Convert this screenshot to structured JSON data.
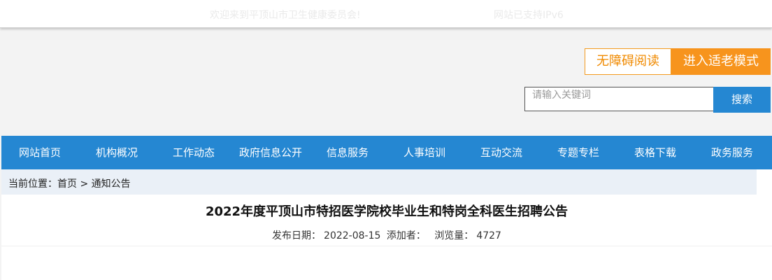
{
  "topbar": {
    "welcome": "欢迎来到平顶山市卫生健康委员会!",
    "ipv6": "网站已支持IPv6"
  },
  "tools": {
    "accessibility_label": "无障碍阅读",
    "elder_mode_label": "进入适老模式"
  },
  "search": {
    "placeholder": "请输入关键词",
    "value": "",
    "button_label": "搜索"
  },
  "nav": {
    "items": [
      {
        "label": "网站首页"
      },
      {
        "label": "机构概况"
      },
      {
        "label": "工作动态"
      },
      {
        "label": "政府信息公开"
      },
      {
        "label": "信息服务"
      },
      {
        "label": "人事培训"
      },
      {
        "label": "互动交流"
      },
      {
        "label": "专题专栏"
      },
      {
        "label": "表格下载"
      },
      {
        "label": "政务服务"
      }
    ]
  },
  "breadcrumb": {
    "prefix": "当前位置：",
    "home": "首页",
    "separator": " > ",
    "current": "通知公告"
  },
  "article": {
    "title": "2022年度平顶山市特招医学院校毕业生和特岗全科医生招聘公告",
    "date_label": "发布日期：",
    "date": "2022-08-15",
    "author_label": "添加者：",
    "author": "",
    "views_label": "浏览量：",
    "views": "4727"
  },
  "colors": {
    "nav_background": "#2587d2",
    "accent_orange": "#f7941d",
    "breadcrumb_background": "#eaf0f7"
  }
}
